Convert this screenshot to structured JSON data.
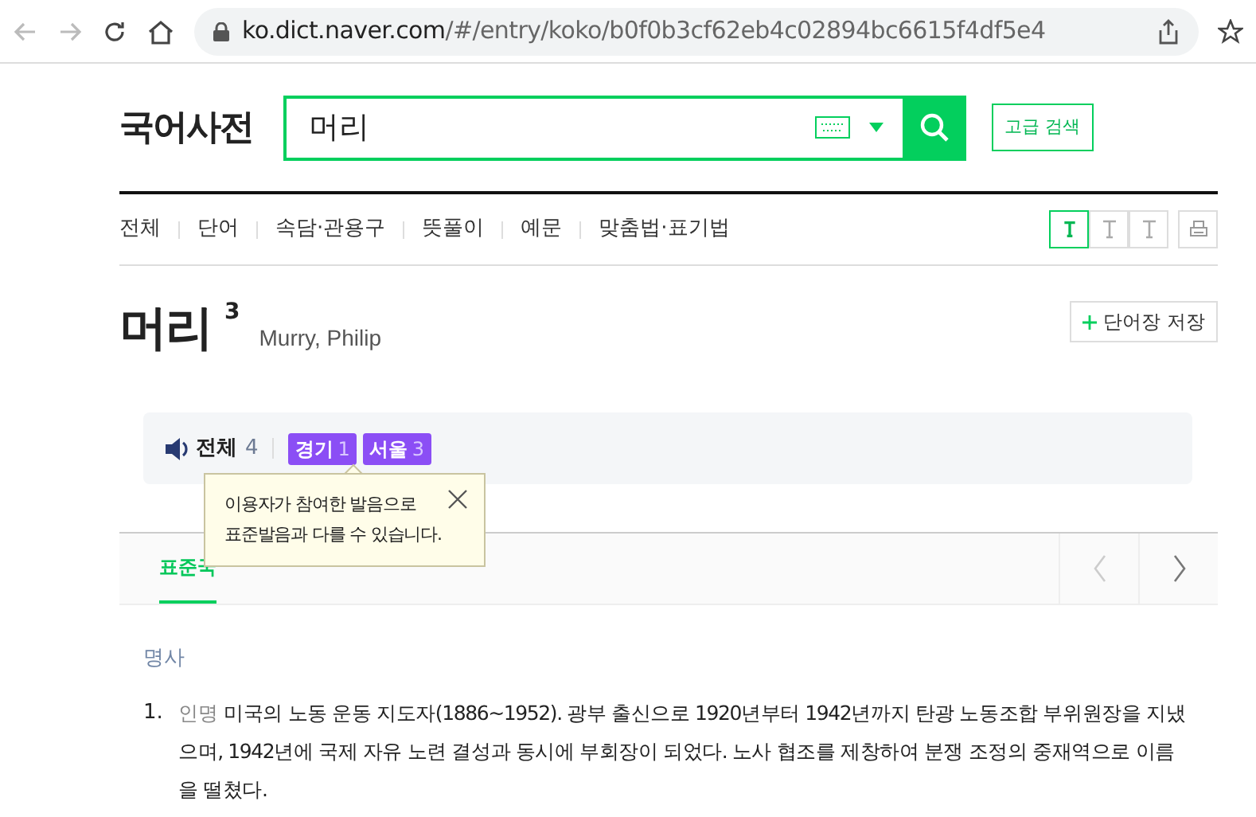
{
  "browser": {
    "url_host": "ko.dict.naver.com",
    "url_path": "/#/entry/koko/b0f0b3cf62eb4c02894bc6615f4df5e4"
  },
  "header": {
    "logo": "국어사전",
    "search_value": "머리",
    "advanced_button": "고급 검색"
  },
  "nav": [
    {
      "label": "전체"
    },
    {
      "label": "단어"
    },
    {
      "label": "속담·관용구"
    },
    {
      "label": "뜻풀이"
    },
    {
      "label": "예문"
    },
    {
      "label": "맞춤법·표기법"
    }
  ],
  "font_sizes": [
    {
      "selected": true
    },
    {
      "selected": false
    },
    {
      "selected": false
    }
  ],
  "entry": {
    "word": "머리",
    "homograph": "3",
    "original": "Murry, Philip",
    "save_button": "단어장 저장"
  },
  "pronunciation": {
    "all_label": "전체",
    "all_count": "4",
    "regions": [
      {
        "name": "경기",
        "count": "1"
      },
      {
        "name": "서울",
        "count": "3"
      }
    ]
  },
  "tooltip": {
    "lines": [
      "이용자가 참여한 발음으로",
      "표준발음과 다를 수 있습니다."
    ]
  },
  "dictionary_tabs": [
    {
      "label": "표준국",
      "selected": true
    }
  ],
  "part_of_speech": "명사",
  "definitions": [
    {
      "number": "1.",
      "category": "인명",
      "text": "미국의 노동 운동 지도자(1886~1952). 광부 출신으로 1920년부터 1942년까지 탄광 노동조합 부위원장을 지냈으며, 1942년에 국제 자유 노련 결성과 동시에 부회장이 되었다. 노사 협조를 제창하여 분쟁 조정의 중재역으로 이름을 떨쳤다."
    }
  ]
}
